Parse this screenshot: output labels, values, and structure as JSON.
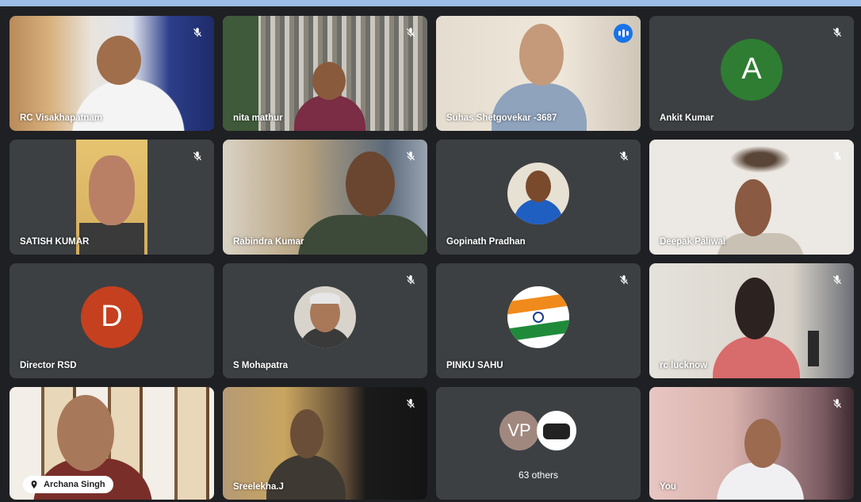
{
  "meeting": {
    "participants": [
      {
        "name": "RC Visakhapatnam"
      },
      {
        "name": "nita mathur"
      },
      {
        "name": "Suhas Shetgovekar -3687"
      },
      {
        "name": "Ankit Kumar",
        "initial": "A"
      },
      {
        "name": "SATISH KUMAR"
      },
      {
        "name": "Rabindra Kumar"
      },
      {
        "name": "Gopinath Pradhan"
      },
      {
        "name": "Deepak Paliwal"
      },
      {
        "name": "Director RSD",
        "initial": "D"
      },
      {
        "name": "S Mohapatra"
      },
      {
        "name": "PINKU SAHU"
      },
      {
        "name": "rc lucknow"
      },
      {
        "name": "Archana Singh"
      },
      {
        "name": "Sreelekha.J"
      },
      {
        "name": "63 others",
        "initial": "VP"
      },
      {
        "name": "You"
      }
    ]
  },
  "colors": {
    "tile_bg": "#3c4043",
    "avatar_a": "#2e7d32",
    "avatar_d": "#c5401e",
    "avatar_vp": "#a1887f",
    "active_border": "#8ab4f8"
  },
  "icons": {
    "mute": "mic-off-icon",
    "speaking": "audio-level-icon",
    "pin": "pin-icon"
  }
}
